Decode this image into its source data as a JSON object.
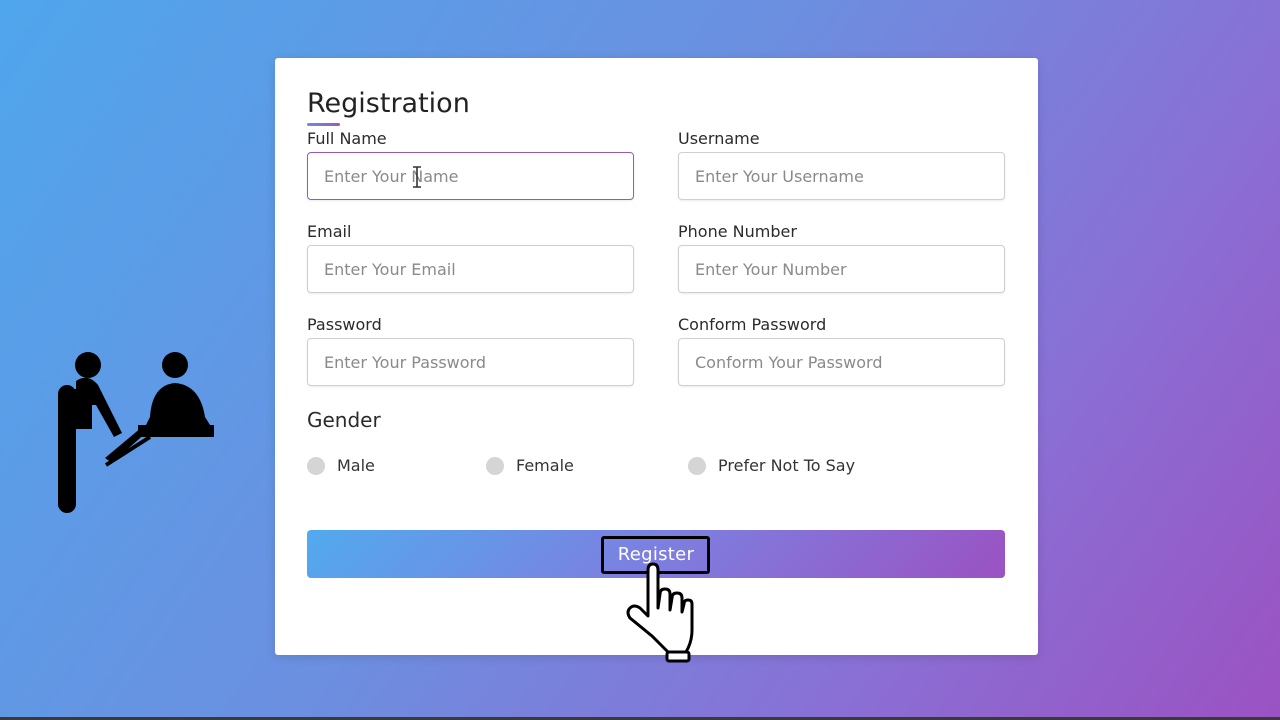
{
  "form": {
    "title": "Registration",
    "fields": [
      {
        "label": "Full Name",
        "placeholder": "Enter Your Name"
      },
      {
        "label": "Username",
        "placeholder": "Enter Your Username"
      },
      {
        "label": "Email",
        "placeholder": "Enter Your Email"
      },
      {
        "label": "Phone Number",
        "placeholder": "Enter Your Number"
      },
      {
        "label": "Password",
        "placeholder": "Enter Your Password"
      },
      {
        "label": "Conform Password",
        "placeholder": "Conform Your Password"
      }
    ],
    "gender": {
      "title": "Gender",
      "options": [
        "Male",
        "Female",
        "Prefer Not To Say"
      ]
    },
    "register_label": "Register"
  },
  "icons": [
    "customer-service-icon",
    "text-cursor-icon",
    "pointer-hand-icon"
  ],
  "colors": {
    "accent_start": "#52aaee",
    "accent_end": "#9b52c2",
    "focus_border": "#9b59b6"
  }
}
